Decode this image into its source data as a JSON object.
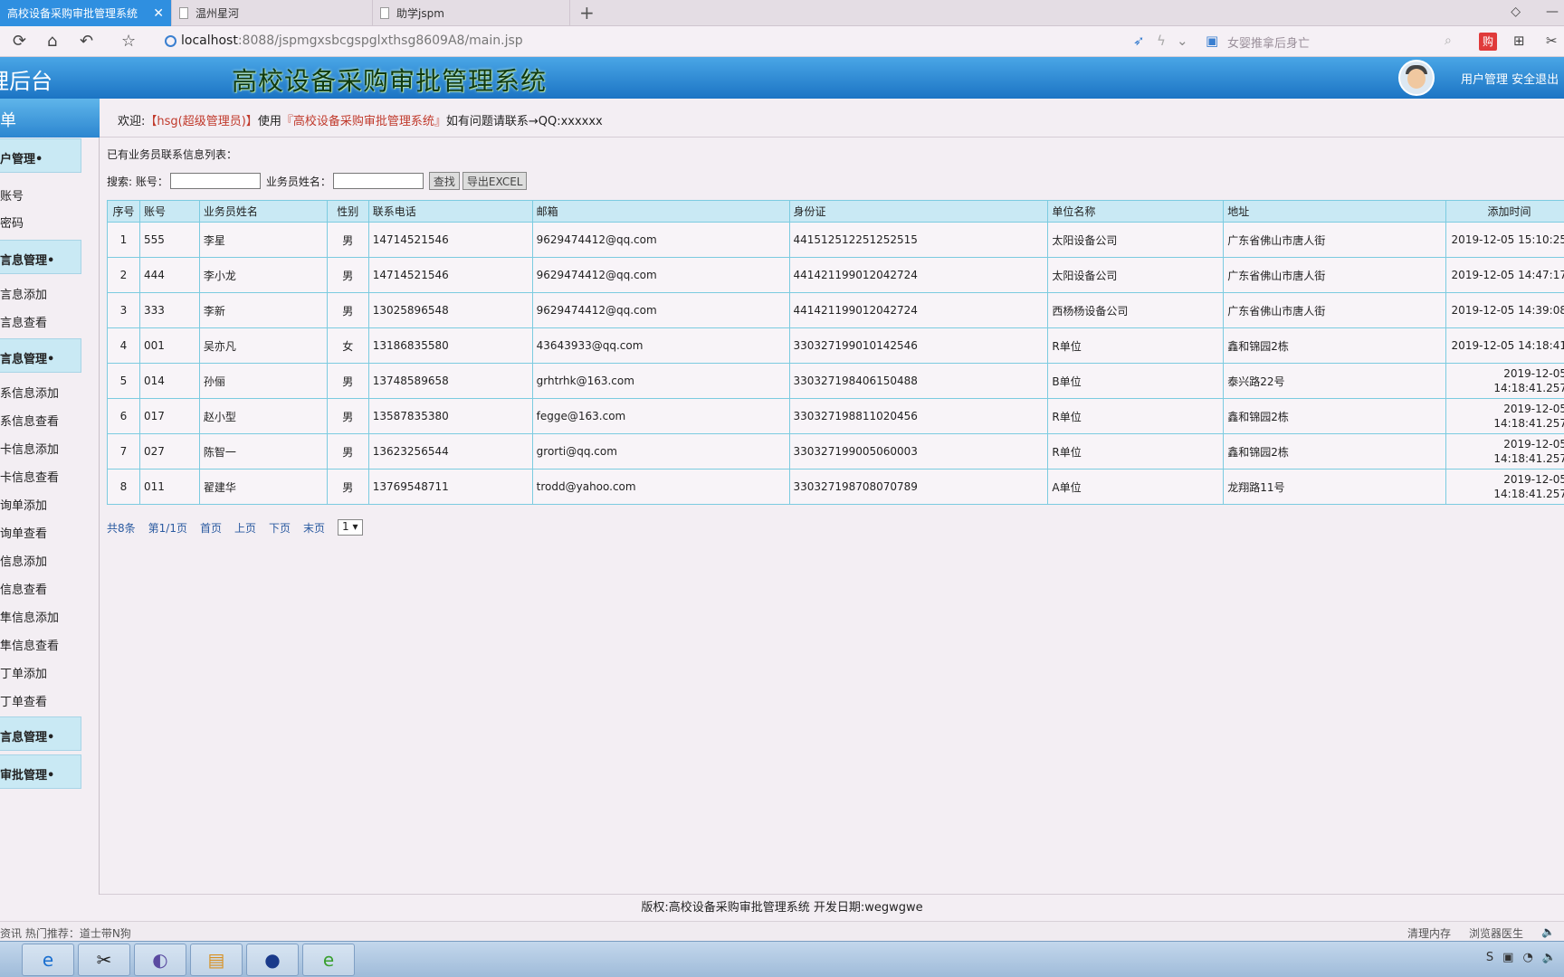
{
  "browser": {
    "tabs": [
      {
        "label": "高校设备采购审批管理系统",
        "active": true
      },
      {
        "label": "温州星河",
        "active": false
      },
      {
        "label": "助学jspm",
        "active": false
      }
    ],
    "url_host": "localhost",
    "url_path": ":8088/jspmgxsbcgspglxthsg8609A8/main.jsp",
    "search_hint": "女婴推拿后身亡",
    "buy_label": "购"
  },
  "header": {
    "admin_title": "理后台",
    "system_title": "高校设备采购审批管理系统",
    "user_manage": "用户管理",
    "logout": "安全退出"
  },
  "sidebar": {
    "menu_title": "单",
    "groups": [
      {
        "label": "户管理•",
        "items": [
          "账号",
          "密码"
        ]
      },
      {
        "label": "言息管理•",
        "items": [
          "言息添加",
          "言息查看"
        ]
      },
      {
        "label": "言息管理•",
        "items": [
          "系信息添加",
          "系信息查看",
          "卡信息添加",
          "卡信息查看",
          "询单添加",
          "询单查看",
          "信息添加",
          "信息查看",
          "隼信息添加",
          "隼信息查看",
          "丁单添加",
          "丁单查看"
        ]
      },
      {
        "label": "言息管理•",
        "items": []
      },
      {
        "label": "审批管理•",
        "items": []
      }
    ]
  },
  "welcome": {
    "prefix": "欢迎:",
    "user": "【hsg(超级管理员)】",
    "middle": "使用",
    "system": "『高校设备采购审批管理系统』",
    "suffix": "如有问题请联系→QQ:xxxxxx"
  },
  "list": {
    "caption": "已有业务员联系信息列表：",
    "search_label": "搜索: 账号：",
    "name_label": "业务员姓名：",
    "search_btn": "查找",
    "export_btn": "导出EXCEL",
    "columns": [
      "序号",
      "账号",
      "业务员姓名",
      "性别",
      "联系电话",
      "邮箱",
      "身份证",
      "单位名称",
      "地址",
      "添加时间"
    ],
    "rows": [
      [
        "1",
        "555",
        "李星",
        "男",
        "14714521546",
        "9629474412@qq.com",
        "441512512251252515",
        "太阳设备公司",
        "广东省佛山市唐人街",
        "2019-12-05 15:10:25"
      ],
      [
        "2",
        "444",
        "李小龙",
        "男",
        "14714521546",
        "9629474412@qq.com",
        "441421199012042724",
        "太阳设备公司",
        "广东省佛山市唐人街",
        "2019-12-05 14:47:17"
      ],
      [
        "3",
        "333",
        "李新",
        "男",
        "13025896548",
        "9629474412@qq.com",
        "441421199012042724",
        "西杨杨设备公司",
        "广东省佛山市唐人街",
        "2019-12-05 14:39:08"
      ],
      [
        "4",
        "001",
        "吴亦凡",
        "女",
        "13186835580",
        "43643933@qq.com",
        "330327199010142546",
        "R单位",
        "鑫和锦园2栋",
        "2019-12-05 14:18:41"
      ],
      [
        "5",
        "014",
        "孙俪",
        "男",
        "13748589658",
        "grhtrhk@163.com",
        "330327198406150488",
        "B单位",
        "泰兴路22号",
        "2019-12-05 14:18:41.257"
      ],
      [
        "6",
        "017",
        "赵小型",
        "男",
        "13587835380",
        "fegge@163.com",
        "330327198811020456",
        "R单位",
        "鑫和锦园2栋",
        "2019-12-05 14:18:41.257"
      ],
      [
        "7",
        "027",
        "陈智一",
        "男",
        "13623256544",
        "grorti@qq.com",
        "330327199005060003",
        "R单位",
        "鑫和锦园2栋",
        "2019-12-05 14:18:41.257"
      ],
      [
        "8",
        "011",
        "翟建华",
        "男",
        "13769548711",
        "trodd@yahoo.com",
        "330327198708070789",
        "A单位",
        "龙翔路11号",
        "2019-12-05 14:18:41.257"
      ]
    ]
  },
  "pager": {
    "total": "共8条",
    "page_info": "第1/1页",
    "first": "首页",
    "prev": "上页",
    "next": "下页",
    "last": "末页",
    "page_select": "1 ▾"
  },
  "footer": "版权:高校设备采购审批管理系统 开发日期:wegwgwe",
  "statusbar": {
    "left": "资讯    热门推荐：道士带N狗",
    "clean_memory": "清理内存",
    "doctor": "浏览器医生"
  }
}
